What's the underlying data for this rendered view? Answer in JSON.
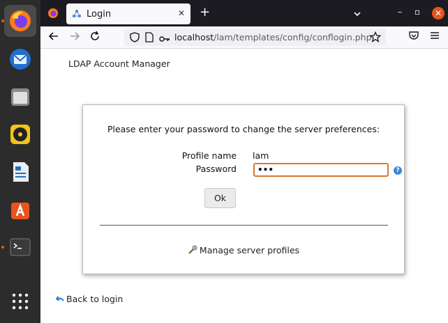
{
  "dock": {
    "items": [
      {
        "name": "firefox-icon"
      },
      {
        "name": "thunderbird-icon"
      },
      {
        "name": "files-icon"
      },
      {
        "name": "rhythmbox-icon"
      },
      {
        "name": "libreoffice-writer-icon"
      },
      {
        "name": "software-center-icon"
      },
      {
        "name": "terminal-icon"
      },
      {
        "name": "app-grid-icon"
      }
    ]
  },
  "browser": {
    "tab_title": "Login",
    "tab_close": "✕",
    "new_tab": "+",
    "url_host": "localhost",
    "url_path": "/lam/templates/config/conflogin.php",
    "window_controls": {
      "minimize": "–",
      "restore": "▫",
      "close": "✕"
    }
  },
  "page": {
    "app_title": "LDAP Account Manager",
    "prompt": "Please enter your password to change the server preferences:",
    "profile_name_label": "Profile name",
    "profile_name_value": "lam",
    "password_label": "Password",
    "password_value": "•••",
    "help_icon": "?",
    "ok_label": "Ok",
    "manage_profiles_label": "Manage server profiles",
    "back_to_login_label": "Back to login"
  },
  "colors": {
    "accent_focus": "#d9772f",
    "firefox_close": "#e9531e",
    "help_blue": "#3d86d8"
  }
}
